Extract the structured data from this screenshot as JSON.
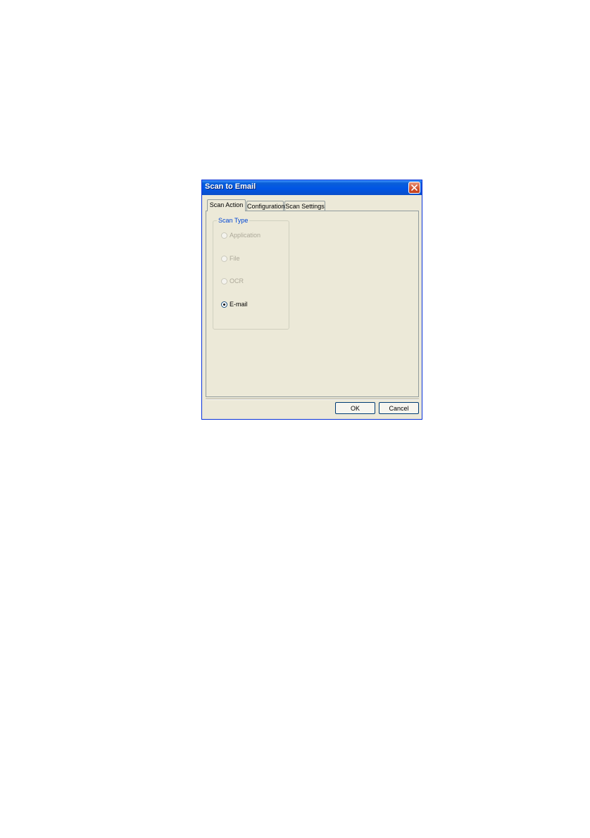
{
  "dialog": {
    "title": "Scan to Email"
  },
  "tabs": [
    {
      "label": "Scan Action",
      "active": true
    },
    {
      "label": "Configuration",
      "active": false
    },
    {
      "label": "Scan Settings",
      "active": false
    }
  ],
  "scan_type": {
    "legend": "Scan Type",
    "options": [
      {
        "label": "Application",
        "enabled": false,
        "selected": false
      },
      {
        "label": "File",
        "enabled": false,
        "selected": false
      },
      {
        "label": "OCR",
        "enabled": false,
        "selected": false
      },
      {
        "label": "E-mail",
        "enabled": true,
        "selected": true
      }
    ]
  },
  "buttons": {
    "ok_label": "OK",
    "cancel_label": "Cancel"
  },
  "colors": {
    "title_bar": "#0055e5",
    "dialog_bg": "#ece9d8",
    "close_button": "#d2502c",
    "group_legend": "#0046d5"
  }
}
